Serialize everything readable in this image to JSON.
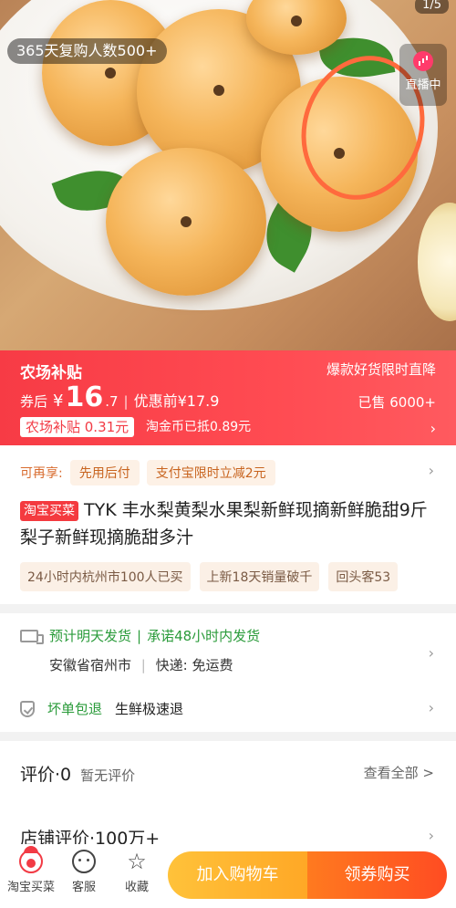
{
  "hero": {
    "counter": "1/5",
    "repurchase_badge": "365天复购人数500+",
    "live_label": "直播中"
  },
  "price_band": {
    "farm_title": "农场补贴",
    "limited_text": "爆款好货限时直降",
    "after_coupon_label": "券后",
    "currency": "¥",
    "price_int": "16",
    "price_dec": ".7",
    "separator": "|",
    "original_price": "优惠前¥17.9",
    "sold": "已售 6000+",
    "subsidy_tag": "农场补贴 0.31元",
    "coin_text": "淘金币已抵0.89元"
  },
  "info": {
    "enjoy_label": "可再享:",
    "enjoy_chips": [
      "先用后付",
      "支付宝限时立减2元"
    ],
    "shop_tag": "淘宝买菜",
    "title": "TYK 丰水梨黄梨水果梨新鲜现摘新鲜脆甜9斤梨子新鲜现摘脆甜多汁",
    "sales_chips": [
      "24小时内杭州市100人已买",
      "上新18天销量破千",
      "回头客53"
    ]
  },
  "shipping": {
    "estimate": "预计明天发货",
    "sep": "|",
    "promise": "承诺48小时内发货",
    "origin": "安徽省宿州市",
    "divider": "|",
    "express": "快递: 免运费",
    "guarantee": "坏单包退",
    "fresh": "生鲜极速退"
  },
  "review": {
    "title": "评价·0",
    "none_text": "暂无评价",
    "view_all": "查看全部 >",
    "store_title": "店铺评价·100万+"
  },
  "bottombar": {
    "tab_home": "淘宝买菜",
    "tab_service": "客服",
    "tab_fav": "收藏",
    "add_cart": "加入购物车",
    "buy_coupon": "领券购买"
  }
}
